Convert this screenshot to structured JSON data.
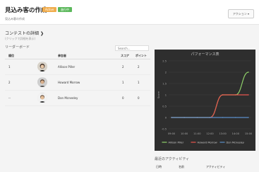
{
  "header": {
    "title": "見込み客の作成",
    "badges": [
      {
        "label": "Active",
        "color": "#f0ad4e"
      },
      {
        "label": "進行中",
        "color": "#5cb85c"
      }
    ],
    "breadcrumb": "見込み客の作成",
    "action_button": "アクション ▾"
  },
  "contest": {
    "title": "コンテストの詳細",
    "subtitle": "(クリックで詳細を表示)"
  },
  "leaderboard": {
    "title": "リーダーボード",
    "search_placeholder": "Search...",
    "columns": {
      "rank": "順位",
      "participant": "参加者",
      "score": "スコア",
      "points": "ポイント"
    },
    "rows": [
      {
        "rank": "1",
        "name": "Allison Piller",
        "score": "2",
        "points": "2"
      },
      {
        "rank": "2",
        "name": "Howard Morrow",
        "score": "1",
        "points": "1"
      },
      {
        "rank": "--",
        "name": "Don Mcneeley",
        "score": "0",
        "points": "0"
      }
    ]
  },
  "activity": {
    "title": "最近のアクティビティ",
    "columns": {
      "date": "日時",
      "name": "名前",
      "activity": "アクティビティ"
    }
  },
  "chart_data": {
    "type": "line",
    "title": "パフォーマンス表",
    "ylabel": "Score",
    "x": [
      "09:00",
      "10:00",
      "11:00",
      "12:00",
      "13:00",
      "14:00",
      "15:00"
    ],
    "ylim": [
      -0.5,
      2.5
    ],
    "yticks": [
      -0.5,
      0,
      0.5,
      1,
      1.5,
      2,
      2.5
    ],
    "grid": true,
    "legend": "bottom",
    "colors": {
      "Allison Piller": "#8fd16a",
      "Howard Morrow": "#e8554e",
      "Don Mcneeley": "#5b8fc9"
    },
    "series": [
      {
        "name": "Allison Piller",
        "values": [
          0,
          0,
          0,
          0,
          1,
          1,
          2
        ]
      },
      {
        "name": "Howard Morrow",
        "values": [
          0,
          0,
          0,
          0,
          1,
          1,
          1
        ]
      },
      {
        "name": "Don Mcneeley",
        "values": [
          0,
          0,
          0,
          0,
          0,
          0,
          0
        ]
      }
    ]
  }
}
